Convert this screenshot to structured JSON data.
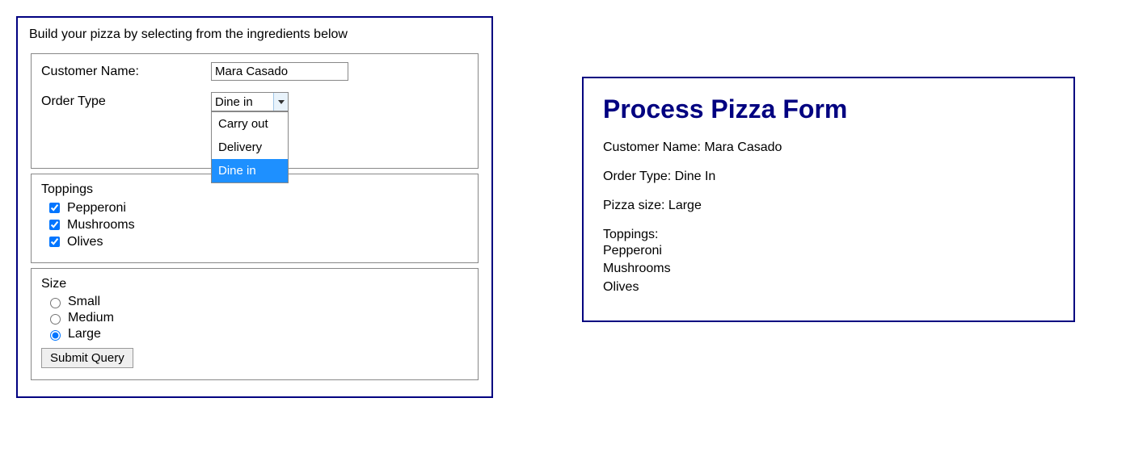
{
  "form": {
    "instruction": "Build your pizza by selecting from the ingredients below",
    "customer_label": "Customer Name:",
    "customer_value": "Mara Casado",
    "order_type_label": "Order Type",
    "order_type_selected": "Dine in",
    "order_type_options": {
      "opt0": "Carry out",
      "opt1": "Delivery",
      "opt2": "Dine in"
    },
    "toppings_label": "Toppings",
    "toppings": {
      "pepperoni": "Pepperoni",
      "mushrooms": "Mushrooms",
      "olives": "Olives"
    },
    "size_label": "Size",
    "sizes": {
      "small": "Small",
      "medium": "Medium",
      "large": "Large"
    },
    "submit_label": "Submit Query"
  },
  "result": {
    "title": "Process Pizza Form",
    "customer": "Customer Name: Mara Casado",
    "order_type": "Order Type: Dine In",
    "size": "Pizza size: Large",
    "toppings_label": "Toppings:",
    "toppings": {
      "t0": "Pepperoni",
      "t1": "Mushrooms",
      "t2": "Olives"
    }
  }
}
